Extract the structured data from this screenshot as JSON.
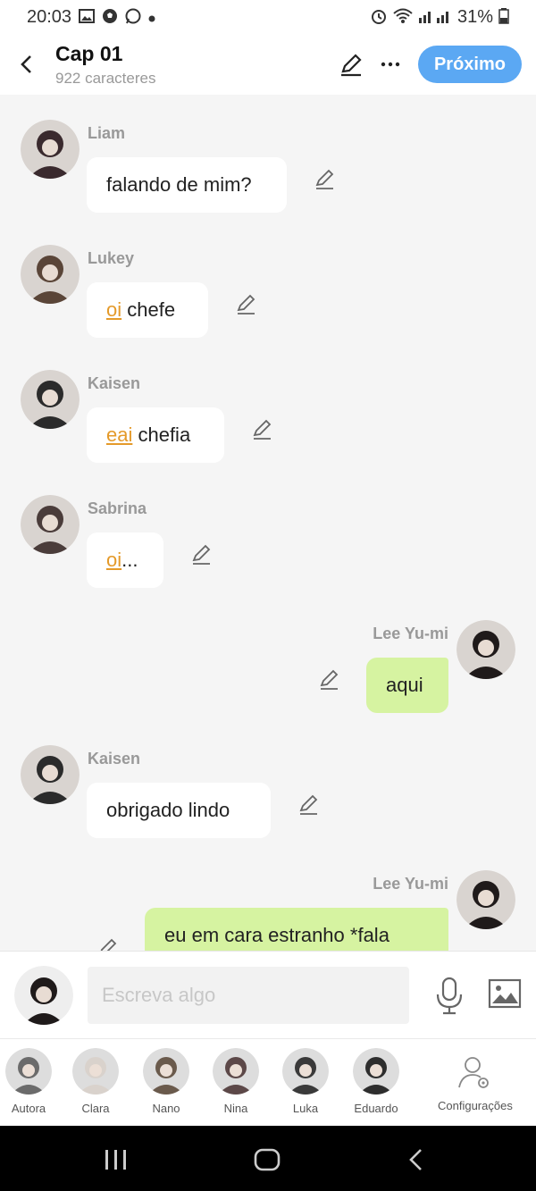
{
  "status_bar": {
    "time": "20:03",
    "battery": "31%"
  },
  "header": {
    "title": "Cap 01",
    "subtitle": "922 caracteres",
    "next_label": "Próximo"
  },
  "messages": [
    {
      "name": "Liam",
      "hl": "",
      "text": "falando de mim?",
      "me": false,
      "avatar_color": "#3a2a2e"
    },
    {
      "name": "Lukey",
      "hl": "oi",
      "text": " chefe",
      "me": false,
      "avatar_color": "#5a4538"
    },
    {
      "name": "Kaisen",
      "hl": "eai",
      "text": " chefia",
      "me": false,
      "avatar_color": "#2b2b2b"
    },
    {
      "name": "Sabrina",
      "hl": "oi",
      "text": "...",
      "me": false,
      "avatar_color": "#4a3c3a"
    },
    {
      "name": "Lee Yu-mi",
      "hl": "",
      "text": "aqui",
      "me": true,
      "avatar_color": "#1f1a1a"
    },
    {
      "name": "Kaisen",
      "hl": "",
      "text": "obrigado lindo",
      "me": false,
      "avatar_color": "#2b2b2b"
    },
    {
      "name": "Lee Yu-mi",
      "hl": "",
      "text": "eu em cara estranho *fala",
      "me": true,
      "avatar_color": "#1f1a1a"
    }
  ],
  "composer": {
    "placeholder": "Escreva algo"
  },
  "characters": [
    {
      "label": "Autora",
      "color": "#6b6b6b"
    },
    {
      "label": "Clara",
      "color": "#d9d2cc"
    },
    {
      "label": "Nano",
      "color": "#6a5a4c"
    },
    {
      "label": "Nina",
      "color": "#5c4848"
    },
    {
      "label": "Luka",
      "color": "#3a3a3a"
    },
    {
      "label": "Eduardo",
      "color": "#2e2e2e"
    }
  ],
  "settings_label": "Configurações",
  "colors": {
    "accent": "#5ba8f3",
    "my_bubble": "#d6f3a1",
    "highlight": "#e49a2a"
  }
}
